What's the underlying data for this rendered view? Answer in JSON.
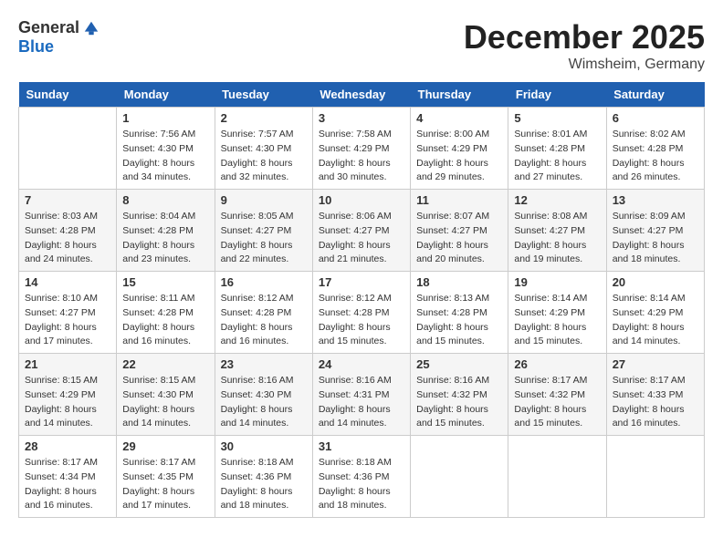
{
  "logo": {
    "general": "General",
    "blue": "Blue"
  },
  "header": {
    "month": "December 2025",
    "location": "Wimsheim, Germany"
  },
  "days_of_week": [
    "Sunday",
    "Monday",
    "Tuesday",
    "Wednesday",
    "Thursday",
    "Friday",
    "Saturday"
  ],
  "weeks": [
    [
      {
        "day": "",
        "info": ""
      },
      {
        "day": "1",
        "info": "Sunrise: 7:56 AM\nSunset: 4:30 PM\nDaylight: 8 hours\nand 34 minutes."
      },
      {
        "day": "2",
        "info": "Sunrise: 7:57 AM\nSunset: 4:30 PM\nDaylight: 8 hours\nand 32 minutes."
      },
      {
        "day": "3",
        "info": "Sunrise: 7:58 AM\nSunset: 4:29 PM\nDaylight: 8 hours\nand 30 minutes."
      },
      {
        "day": "4",
        "info": "Sunrise: 8:00 AM\nSunset: 4:29 PM\nDaylight: 8 hours\nand 29 minutes."
      },
      {
        "day": "5",
        "info": "Sunrise: 8:01 AM\nSunset: 4:28 PM\nDaylight: 8 hours\nand 27 minutes."
      },
      {
        "day": "6",
        "info": "Sunrise: 8:02 AM\nSunset: 4:28 PM\nDaylight: 8 hours\nand 26 minutes."
      }
    ],
    [
      {
        "day": "7",
        "info": "Sunrise: 8:03 AM\nSunset: 4:28 PM\nDaylight: 8 hours\nand 24 minutes."
      },
      {
        "day": "8",
        "info": "Sunrise: 8:04 AM\nSunset: 4:28 PM\nDaylight: 8 hours\nand 23 minutes."
      },
      {
        "day": "9",
        "info": "Sunrise: 8:05 AM\nSunset: 4:27 PM\nDaylight: 8 hours\nand 22 minutes."
      },
      {
        "day": "10",
        "info": "Sunrise: 8:06 AM\nSunset: 4:27 PM\nDaylight: 8 hours\nand 21 minutes."
      },
      {
        "day": "11",
        "info": "Sunrise: 8:07 AM\nSunset: 4:27 PM\nDaylight: 8 hours\nand 20 minutes."
      },
      {
        "day": "12",
        "info": "Sunrise: 8:08 AM\nSunset: 4:27 PM\nDaylight: 8 hours\nand 19 minutes."
      },
      {
        "day": "13",
        "info": "Sunrise: 8:09 AM\nSunset: 4:27 PM\nDaylight: 8 hours\nand 18 minutes."
      }
    ],
    [
      {
        "day": "14",
        "info": "Sunrise: 8:10 AM\nSunset: 4:27 PM\nDaylight: 8 hours\nand 17 minutes."
      },
      {
        "day": "15",
        "info": "Sunrise: 8:11 AM\nSunset: 4:28 PM\nDaylight: 8 hours\nand 16 minutes."
      },
      {
        "day": "16",
        "info": "Sunrise: 8:12 AM\nSunset: 4:28 PM\nDaylight: 8 hours\nand 16 minutes."
      },
      {
        "day": "17",
        "info": "Sunrise: 8:12 AM\nSunset: 4:28 PM\nDaylight: 8 hours\nand 15 minutes."
      },
      {
        "day": "18",
        "info": "Sunrise: 8:13 AM\nSunset: 4:28 PM\nDaylight: 8 hours\nand 15 minutes."
      },
      {
        "day": "19",
        "info": "Sunrise: 8:14 AM\nSunset: 4:29 PM\nDaylight: 8 hours\nand 15 minutes."
      },
      {
        "day": "20",
        "info": "Sunrise: 8:14 AM\nSunset: 4:29 PM\nDaylight: 8 hours\nand 14 minutes."
      }
    ],
    [
      {
        "day": "21",
        "info": "Sunrise: 8:15 AM\nSunset: 4:29 PM\nDaylight: 8 hours\nand 14 minutes."
      },
      {
        "day": "22",
        "info": "Sunrise: 8:15 AM\nSunset: 4:30 PM\nDaylight: 8 hours\nand 14 minutes."
      },
      {
        "day": "23",
        "info": "Sunrise: 8:16 AM\nSunset: 4:30 PM\nDaylight: 8 hours\nand 14 minutes."
      },
      {
        "day": "24",
        "info": "Sunrise: 8:16 AM\nSunset: 4:31 PM\nDaylight: 8 hours\nand 14 minutes."
      },
      {
        "day": "25",
        "info": "Sunrise: 8:16 AM\nSunset: 4:32 PM\nDaylight: 8 hours\nand 15 minutes."
      },
      {
        "day": "26",
        "info": "Sunrise: 8:17 AM\nSunset: 4:32 PM\nDaylight: 8 hours\nand 15 minutes."
      },
      {
        "day": "27",
        "info": "Sunrise: 8:17 AM\nSunset: 4:33 PM\nDaylight: 8 hours\nand 16 minutes."
      }
    ],
    [
      {
        "day": "28",
        "info": "Sunrise: 8:17 AM\nSunset: 4:34 PM\nDaylight: 8 hours\nand 16 minutes."
      },
      {
        "day": "29",
        "info": "Sunrise: 8:17 AM\nSunset: 4:35 PM\nDaylight: 8 hours\nand 17 minutes."
      },
      {
        "day": "30",
        "info": "Sunrise: 8:18 AM\nSunset: 4:36 PM\nDaylight: 8 hours\nand 18 minutes."
      },
      {
        "day": "31",
        "info": "Sunrise: 8:18 AM\nSunset: 4:36 PM\nDaylight: 8 hours\nand 18 minutes."
      },
      {
        "day": "",
        "info": ""
      },
      {
        "day": "",
        "info": ""
      },
      {
        "day": "",
        "info": ""
      }
    ]
  ]
}
